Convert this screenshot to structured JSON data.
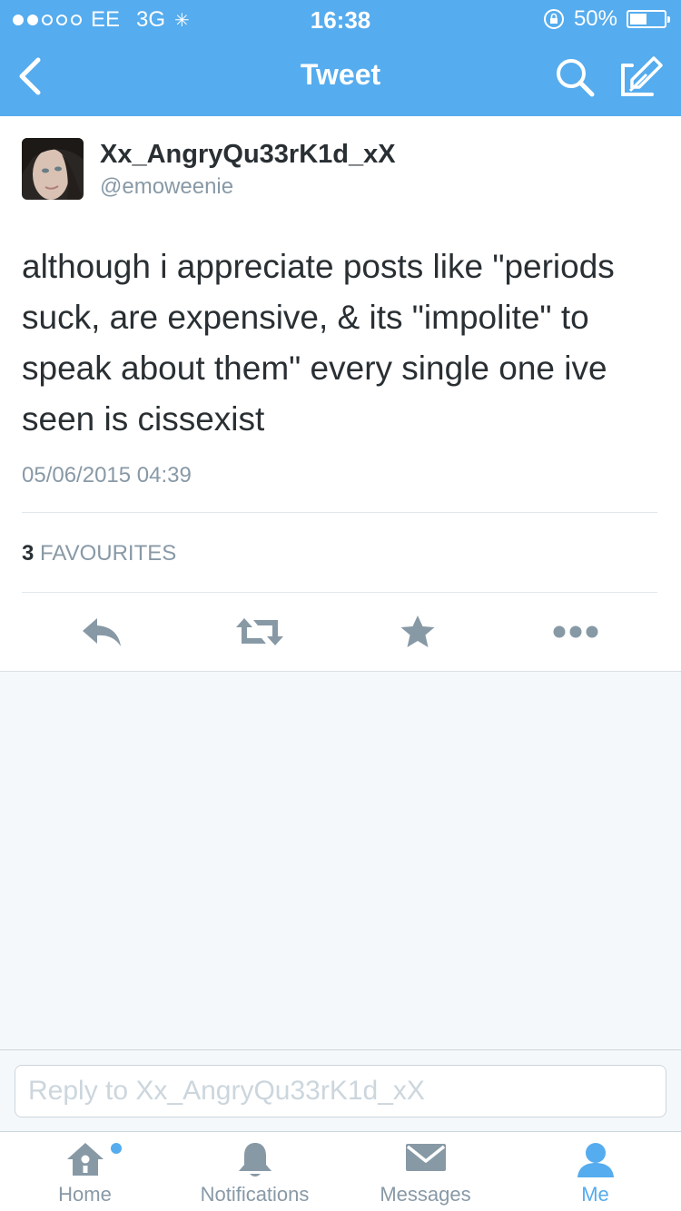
{
  "status_bar": {
    "carrier": "EE",
    "network": "3G",
    "time": "16:38",
    "battery": "50%",
    "battery_level": 0.5
  },
  "nav": {
    "title": "Tweet"
  },
  "tweet": {
    "display_name": "Xx_AngryQu33rK1d_xX",
    "handle": "@emoweenie",
    "text": "although i appreciate posts like \"periods suck, are expensive, & its \"impolite\" to speak about them\" every single one ive seen is cissexist",
    "timestamp": "05/06/2015 04:39",
    "favourites_count": "3",
    "favourites_label": "FAVOURITES"
  },
  "reply": {
    "placeholder": "Reply to Xx_AngryQu33rK1d_xX"
  },
  "tabs": [
    {
      "label": "Home",
      "icon": "home-icon"
    },
    {
      "label": "Notifications",
      "icon": "bell-icon"
    },
    {
      "label": "Messages",
      "icon": "envelope-icon"
    },
    {
      "label": "Me",
      "icon": "person-icon"
    }
  ],
  "colors": {
    "brand": "#55acee",
    "text": "#292f33",
    "muted": "#8899a6",
    "background": "#f5f8fa"
  }
}
